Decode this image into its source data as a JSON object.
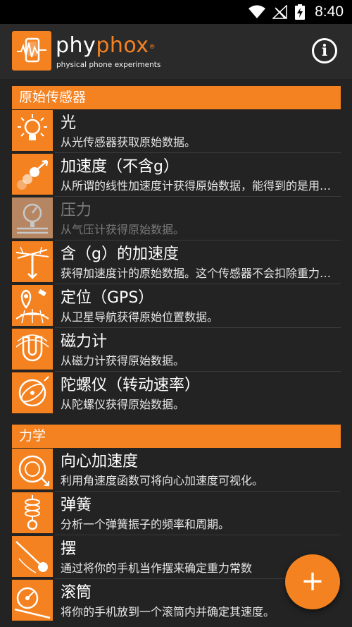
{
  "status_bar": {
    "time": "8:40"
  },
  "app_bar": {
    "logo_word_a": "phy",
    "logo_word_b": "phox",
    "logo_mark": "®",
    "tagline": "physical phone experiments",
    "info_icon_glyph": "i"
  },
  "colors": {
    "accent": "#f58220",
    "background": "#232323",
    "toolbar": "#2a2a2a"
  },
  "sections": [
    {
      "title": "原始传感器",
      "items": [
        {
          "icon": "light-bulb-icon",
          "title": "光",
          "desc": "从光传感器获取原始数据。",
          "enabled": true
        },
        {
          "icon": "acceleration-icon",
          "title": "加速度（不含g）",
          "desc": "从所谓的线性加速度计获得原始数据，能得到的是用户操作手机时产生的加速度。",
          "enabled": true
        },
        {
          "icon": "pressure-gauge-icon",
          "title": "压力",
          "desc": "从气压计获得原始数据。",
          "enabled": false
        },
        {
          "icon": "gravity-axes-icon",
          "title": "含（g）的加速度",
          "desc": "获得加速度计的原始数据。这个传感器不会扣除重力加速度。",
          "enabled": true
        },
        {
          "icon": "gps-location-icon",
          "title": "定位（GPS）",
          "desc": "从卫星导航获得原始位置数据。",
          "enabled": true
        },
        {
          "icon": "magnet-icon",
          "title": "磁力计",
          "desc": "从磁力计获得原始数据。",
          "enabled": true
        },
        {
          "icon": "gyroscope-icon",
          "title": "陀螺仪（转动速率）",
          "desc": "从陀螺仪获得原始数据。",
          "enabled": true
        }
      ]
    },
    {
      "title": "力学",
      "items": [
        {
          "icon": "centripetal-icon",
          "title": "向心加速度",
          "desc": "利用角速度函数可将向心加速度可视化。",
          "enabled": true
        },
        {
          "icon": "spring-icon",
          "title": "弹簧",
          "desc": "分析一个弹簧振子的频率和周期。",
          "enabled": true
        },
        {
          "icon": "pendulum-icon",
          "title": "摆",
          "desc": "通过将你的手机当作摆来确定重力常数",
          "enabled": true
        },
        {
          "icon": "roll-icon",
          "title": "滚筒",
          "desc": "将你的手机放到一个滚筒内并确定其速度。",
          "enabled": true
        }
      ]
    }
  ],
  "fab": {
    "glyph": "+"
  }
}
